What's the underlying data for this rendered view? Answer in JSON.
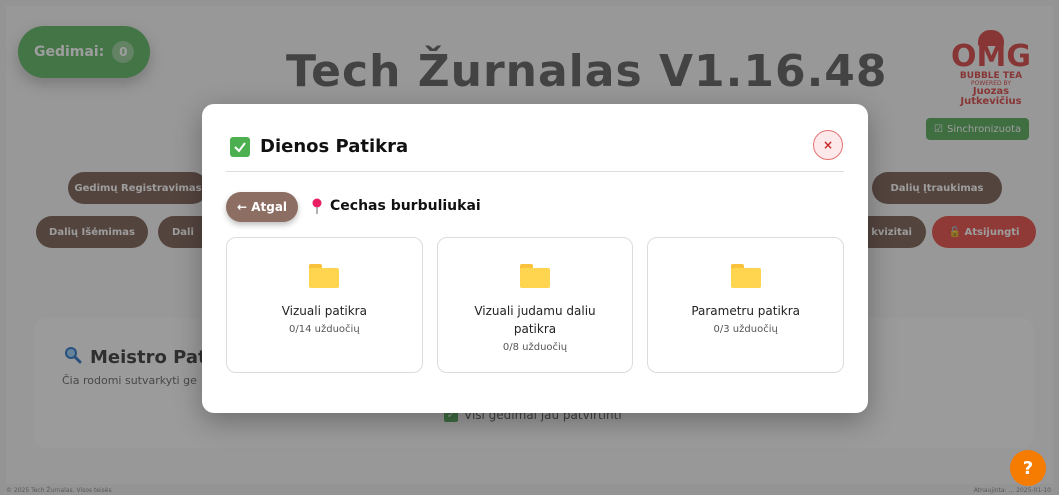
{
  "app": {
    "gedimai_label": "Gedimai:",
    "gedimai_count": "0",
    "title": "Tech Žurnalas V1.16.48",
    "logo": {
      "main": "OMG",
      "sub": "BUBBLE TEA",
      "powered": "POWERED BY",
      "name_first": "Juozas",
      "name_last": "Jutkevičius"
    },
    "sync_label": "Sinchronizuota",
    "nav": {
      "gedimu_registravimas": "Gedimų Registravimas",
      "daliu_itraukimas": "Dalių Įtraukimas",
      "daliu_isemimas": "Dalių Išėmimas",
      "daliu_partial": "Dali",
      "rekvizitai_partial": "kvizitai",
      "atsijungti": "Atsijungti"
    },
    "meistro": {
      "title": "Meistro Pat",
      "subtitle": "Čia rodomi sutvarkyti ge",
      "status": "Visi gedimai jau patvirtinti"
    },
    "help_label": "?",
    "footer_left": "© 2025 Tech Žurnalas. Visos teisės",
    "footer_right": "Atnaujinta: ... 2025-01-10"
  },
  "modal": {
    "title": "Dienos Patikra",
    "close_label": "×",
    "back_label": "← Atgal",
    "location": "Cechas burbuliukai",
    "cards": [
      {
        "title": "Vizuali patikra",
        "count": "0/14 užduočių"
      },
      {
        "title": "Vizuali judamu daliu patikra",
        "count": "0/8 užduočių"
      },
      {
        "title": "Parametru patikra",
        "count": "0/3 užduočių"
      }
    ]
  },
  "colors": {
    "green": "#4caf50",
    "brown": "#6d4c41",
    "red": "#e53935",
    "orange": "#f57c00",
    "folder": "#ffd54f"
  },
  "icons": {
    "header_check": "check-square-icon",
    "location": "map-pin-icon",
    "card": "folder-icon",
    "meistro": "magnifier-icon"
  }
}
